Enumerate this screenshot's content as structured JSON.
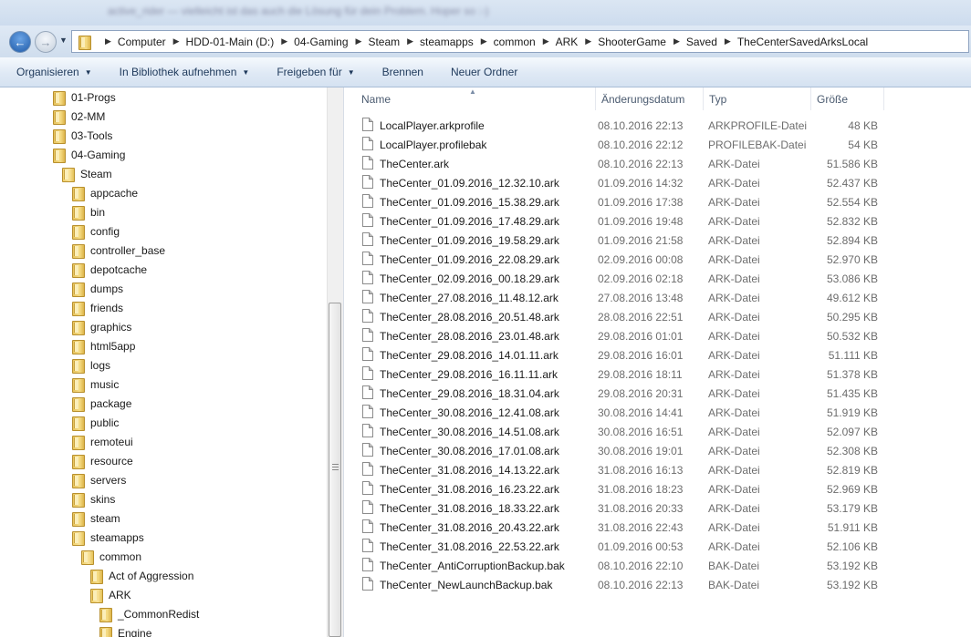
{
  "window": {
    "blurred_title": "active_rider — vielleicht ist das auch die Lösung für dein Problem. Hoper so :-)"
  },
  "address": {
    "crumbs": [
      "Computer",
      "HDD-01-Main (D:)",
      "04-Gaming",
      "Steam",
      "steamapps",
      "common",
      "ARK",
      "ShooterGame",
      "Saved",
      "TheCenterSavedArksLocal"
    ]
  },
  "toolbar": {
    "organize": "Organisieren",
    "library": "In Bibliothek aufnehmen",
    "share": "Freigeben für",
    "burn": "Brennen",
    "new_folder": "Neuer Ordner"
  },
  "nav": {
    "items": [
      {
        "label": "01-Progs",
        "indent": 0
      },
      {
        "label": "02-MM",
        "indent": 0
      },
      {
        "label": "03-Tools",
        "indent": 0
      },
      {
        "label": "04-Gaming",
        "indent": 0
      },
      {
        "label": "Steam",
        "indent": 1
      },
      {
        "label": "appcache",
        "indent": 2
      },
      {
        "label": "bin",
        "indent": 2
      },
      {
        "label": "config",
        "indent": 2
      },
      {
        "label": "controller_base",
        "indent": 2
      },
      {
        "label": "depotcache",
        "indent": 2
      },
      {
        "label": "dumps",
        "indent": 2
      },
      {
        "label": "friends",
        "indent": 2
      },
      {
        "label": "graphics",
        "indent": 2
      },
      {
        "label": "html5app",
        "indent": 2
      },
      {
        "label": "logs",
        "indent": 2
      },
      {
        "label": "music",
        "indent": 2
      },
      {
        "label": "package",
        "indent": 2
      },
      {
        "label": "public",
        "indent": 2
      },
      {
        "label": "remoteui",
        "indent": 2
      },
      {
        "label": "resource",
        "indent": 2
      },
      {
        "label": "servers",
        "indent": 2
      },
      {
        "label": "skins",
        "indent": 2
      },
      {
        "label": "steam",
        "indent": 2
      },
      {
        "label": "steamapps",
        "indent": 2
      },
      {
        "label": "common",
        "indent": 3
      },
      {
        "label": "Act of Aggression",
        "indent": 4
      },
      {
        "label": "ARK",
        "indent": 4
      },
      {
        "label": "_CommonRedist",
        "indent": 5
      },
      {
        "label": "Engine",
        "indent": 5
      }
    ]
  },
  "columns": {
    "name": "Name",
    "date": "Änderungsdatum",
    "type": "Typ",
    "size": "Größe"
  },
  "files": [
    {
      "name": "LocalPlayer.arkprofile",
      "date": "08.10.2016 22:13",
      "type": "ARKPROFILE-Datei",
      "size": "48 KB"
    },
    {
      "name": "LocalPlayer.profilebak",
      "date": "08.10.2016 22:12",
      "type": "PROFILEBAK-Datei",
      "size": "54 KB"
    },
    {
      "name": "TheCenter.ark",
      "date": "08.10.2016 22:13",
      "type": "ARK-Datei",
      "size": "51.586 KB"
    },
    {
      "name": "TheCenter_01.09.2016_12.32.10.ark",
      "date": "01.09.2016 14:32",
      "type": "ARK-Datei",
      "size": "52.437 KB"
    },
    {
      "name": "TheCenter_01.09.2016_15.38.29.ark",
      "date": "01.09.2016 17:38",
      "type": "ARK-Datei",
      "size": "52.554 KB"
    },
    {
      "name": "TheCenter_01.09.2016_17.48.29.ark",
      "date": "01.09.2016 19:48",
      "type": "ARK-Datei",
      "size": "52.832 KB"
    },
    {
      "name": "TheCenter_01.09.2016_19.58.29.ark",
      "date": "01.09.2016 21:58",
      "type": "ARK-Datei",
      "size": "52.894 KB"
    },
    {
      "name": "TheCenter_01.09.2016_22.08.29.ark",
      "date": "02.09.2016 00:08",
      "type": "ARK-Datei",
      "size": "52.970 KB"
    },
    {
      "name": "TheCenter_02.09.2016_00.18.29.ark",
      "date": "02.09.2016 02:18",
      "type": "ARK-Datei",
      "size": "53.086 KB"
    },
    {
      "name": "TheCenter_27.08.2016_11.48.12.ark",
      "date": "27.08.2016 13:48",
      "type": "ARK-Datei",
      "size": "49.612 KB"
    },
    {
      "name": "TheCenter_28.08.2016_20.51.48.ark",
      "date": "28.08.2016 22:51",
      "type": "ARK-Datei",
      "size": "50.295 KB"
    },
    {
      "name": "TheCenter_28.08.2016_23.01.48.ark",
      "date": "29.08.2016 01:01",
      "type": "ARK-Datei",
      "size": "50.532 KB"
    },
    {
      "name": "TheCenter_29.08.2016_14.01.11.ark",
      "date": "29.08.2016 16:01",
      "type": "ARK-Datei",
      "size": "51.111 KB"
    },
    {
      "name": "TheCenter_29.08.2016_16.11.11.ark",
      "date": "29.08.2016 18:11",
      "type": "ARK-Datei",
      "size": "51.378 KB"
    },
    {
      "name": "TheCenter_29.08.2016_18.31.04.ark",
      "date": "29.08.2016 20:31",
      "type": "ARK-Datei",
      "size": "51.435 KB"
    },
    {
      "name": "TheCenter_30.08.2016_12.41.08.ark",
      "date": "30.08.2016 14:41",
      "type": "ARK-Datei",
      "size": "51.919 KB"
    },
    {
      "name": "TheCenter_30.08.2016_14.51.08.ark",
      "date": "30.08.2016 16:51",
      "type": "ARK-Datei",
      "size": "52.097 KB"
    },
    {
      "name": "TheCenter_30.08.2016_17.01.08.ark",
      "date": "30.08.2016 19:01",
      "type": "ARK-Datei",
      "size": "52.308 KB"
    },
    {
      "name": "TheCenter_31.08.2016_14.13.22.ark",
      "date": "31.08.2016 16:13",
      "type": "ARK-Datei",
      "size": "52.819 KB"
    },
    {
      "name": "TheCenter_31.08.2016_16.23.22.ark",
      "date": "31.08.2016 18:23",
      "type": "ARK-Datei",
      "size": "52.969 KB"
    },
    {
      "name": "TheCenter_31.08.2016_18.33.22.ark",
      "date": "31.08.2016 20:33",
      "type": "ARK-Datei",
      "size": "53.179 KB"
    },
    {
      "name": "TheCenter_31.08.2016_20.43.22.ark",
      "date": "31.08.2016 22:43",
      "type": "ARK-Datei",
      "size": "51.911 KB"
    },
    {
      "name": "TheCenter_31.08.2016_22.53.22.ark",
      "date": "01.09.2016 00:53",
      "type": "ARK-Datei",
      "size": "52.106 KB"
    },
    {
      "name": "TheCenter_AntiCorruptionBackup.bak",
      "date": "08.10.2016 22:10",
      "type": "BAK-Datei",
      "size": "53.192 KB"
    },
    {
      "name": "TheCenter_NewLaunchBackup.bak",
      "date": "08.10.2016 22:13",
      "type": "BAK-Datei",
      "size": "53.192 KB"
    }
  ]
}
